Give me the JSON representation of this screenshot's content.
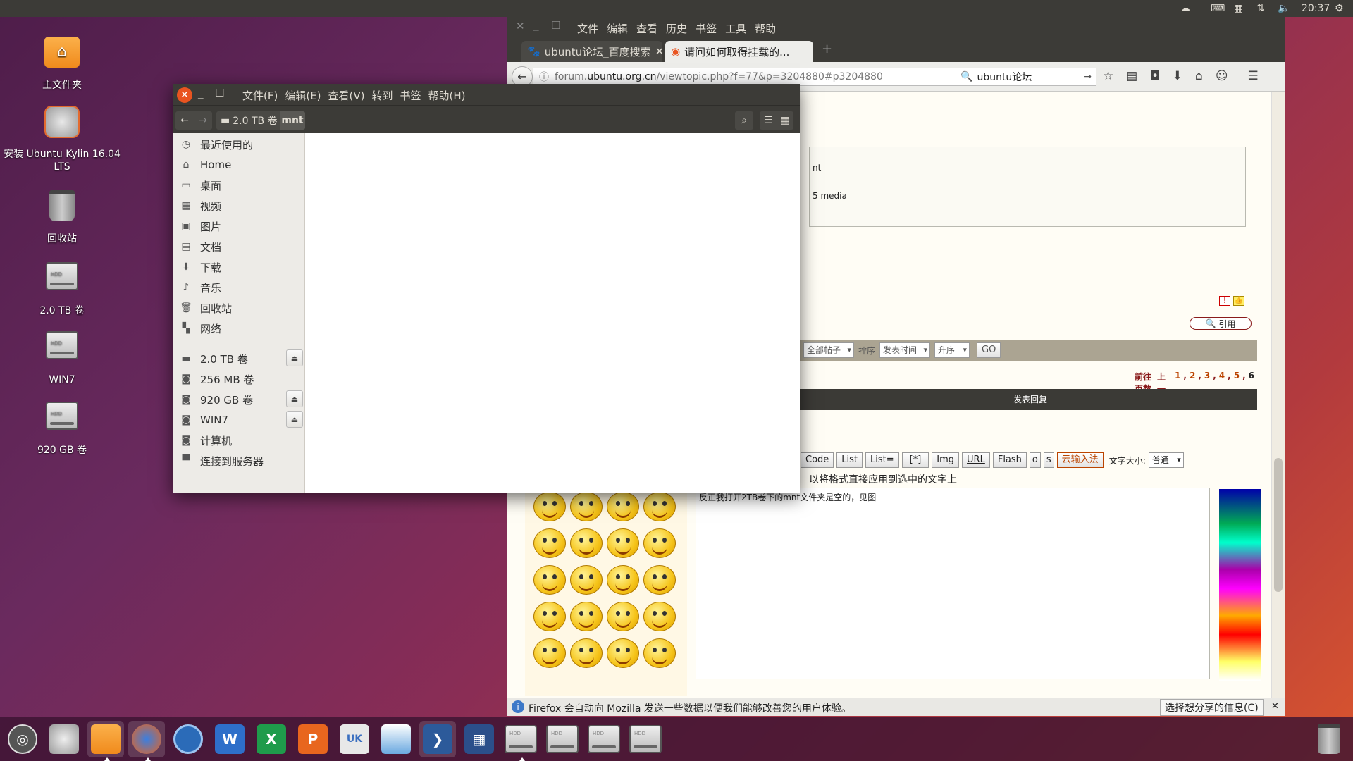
{
  "top_panel": {
    "time": "20:37"
  },
  "desktop_icons": [
    {
      "label": "主文件夹"
    },
    {
      "label": "安装 Ubuntu Kylin 16.04 LTS"
    },
    {
      "label": "回收站"
    },
    {
      "label": "2.0 TB 卷"
    },
    {
      "label": "WIN7"
    },
    {
      "label": "920 GB 卷"
    }
  ],
  "firefox": {
    "menu": [
      "文件",
      "编辑",
      "查看",
      "历史",
      "书签",
      "工具",
      "帮助"
    ],
    "tabs": [
      {
        "title": "ubuntu论坛_百度搜索"
      },
      {
        "title": "请问如何取得挂载的..."
      }
    ],
    "url_prefix": "forum.",
    "url_domain": "ubuntu.org.cn",
    "url_path": "/viewtopic.php?f=77&p=3204880#p3204880",
    "search_value": "ubuntu论坛",
    "content": {
      "box_text_1": "nt",
      "box_text_2": "5 media",
      "quote_label": "引用",
      "filter_all": "全部帖子",
      "sort_label": "排序",
      "sort_field": "发表时间",
      "sort_order": "升序",
      "go": "GO",
      "pagination_prefix": "前往页数",
      "pagination_prev": "上一页",
      "pages": [
        "1",
        "2",
        "3",
        "4",
        "5",
        "6"
      ],
      "reply_header": "发表回复",
      "toolbar_buttons": [
        "Code",
        "List",
        "List=",
        "[*]",
        "Img",
        "URL",
        "Flash",
        "o",
        "s"
      ],
      "ime_button": "云输入法",
      "font_size_label": "文字大小:",
      "font_size_value": "普通",
      "hint_text": "以将格式直接应用到选中的文字上",
      "post_text": "反正我打开2TB卷下的mnt文件夹是空的，见图"
    },
    "notice": {
      "text": "Firefox 会自动向 Mozilla 发送一些数据以便我们能够改善您的用户体验。",
      "button": "选择想分享的信息(C)"
    }
  },
  "nautilus": {
    "menu": [
      "文件(F)",
      "编辑(E)",
      "查看(V)",
      "转到",
      "书签",
      "帮助(H)"
    ],
    "path": [
      "2.0 TB 卷",
      "mnt"
    ],
    "places": [
      {
        "label": "最近使用的",
        "icon": "clock-icon"
      },
      {
        "label": "Home",
        "icon": "home-icon"
      },
      {
        "label": "桌面",
        "icon": "desktop-icon"
      },
      {
        "label": "视频",
        "icon": "video-icon"
      },
      {
        "label": "图片",
        "icon": "picture-icon"
      },
      {
        "label": "文档",
        "icon": "document-icon"
      },
      {
        "label": "下载",
        "icon": "download-icon"
      },
      {
        "label": "音乐",
        "icon": "music-icon"
      },
      {
        "label": "回收站",
        "icon": "trash-icon"
      },
      {
        "label": "网络",
        "icon": "network-icon"
      }
    ],
    "devices": [
      {
        "label": "2.0 TB 卷",
        "eject": true
      },
      {
        "label": "256 MB 卷",
        "eject": false
      },
      {
        "label": "920 GB 卷",
        "eject": true
      },
      {
        "label": "WIN7",
        "eject": true
      },
      {
        "label": "计算机",
        "eject": false
      },
      {
        "label": "连接到服务器",
        "eject": false
      }
    ]
  }
}
